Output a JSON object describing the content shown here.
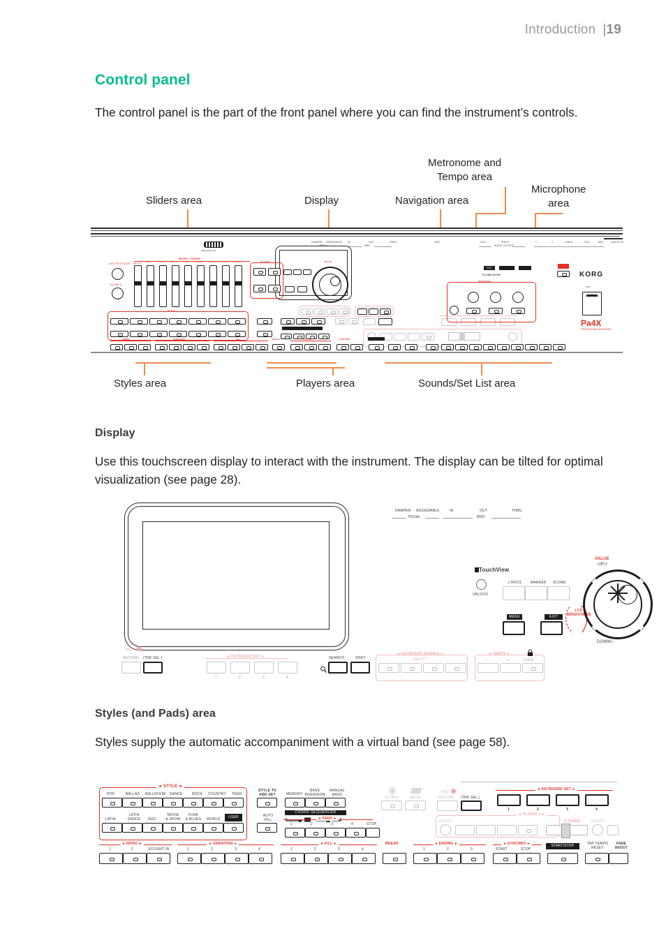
{
  "header": {
    "running_head": "Introduction",
    "page_number": "19",
    "folio_bar": "|"
  },
  "sections": [
    {
      "title": "Control panel",
      "body": "The control panel is the part of the front panel where you can find the instrument’s controls."
    },
    {
      "title": "Display",
      "body": "Use this touchscreen display to interact with the instrument. The display can be tilted for optimal visualization (see page 28)."
    },
    {
      "title": "Styles (and Pads) area",
      "body": "Styles supply the automatic accompaniment with a virtual band (see page 58)."
    }
  ],
  "figure_control_panel": {
    "callouts_top": [
      {
        "label": "Sliders area"
      },
      {
        "label": "Display"
      },
      {
        "label": "Navigation area"
      },
      {
        "label": "Metronome and\nTempo area",
        "line1": "Metronome and",
        "line2": "Tempo area"
      },
      {
        "label": "Microphone\narea",
        "line1": "Microphone",
        "line2": "area"
      }
    ],
    "callouts_bottom": [
      {
        "label": "Styles area"
      },
      {
        "label": "Players area"
      },
      {
        "label": "Sounds/Set List area"
      }
    ],
    "panel_text": {
      "brand": "KORG",
      "model": "Pa4X",
      "model_sub": "PROFESSIONAL ARRANGER",
      "speaker_label": "SPEAKER ON",
      "master_volume": "MASTER VOLUME",
      "balance": "BALANCE",
      "mixer_header": "MIXER / TUNING",
      "slider_labels": [
        "KBD VOL.",
        "PAD 1\nBASS",
        "PAD 2\nPERC.",
        "PAD 3\nGUITAR",
        "PAD 4\nACC 1",
        "LOWER\nACC 2",
        "UPPER 3\nACC 3",
        "UPPER 2\nACC 4",
        "UPPER 1\nDRUM"
      ],
      "player_header": "PLAYER",
      "player_buttons": [
        "SONG PLAY",
        "SONG PLAY",
        "SEQUENCER",
        "SOUND"
      ],
      "style_header": "STYLE",
      "style_row1": [
        "POP",
        "BALLAD",
        "BALLROOM",
        "DANCE",
        "ROCK",
        "COUNTRY",
        "TRAD."
      ],
      "style_row2": [
        "LATIN",
        "LATIN DANCE",
        "JAZZ",
        "MOVIE & SHOW",
        "FUNK & BLUES",
        "WORLD",
        "USER"
      ],
      "style_to_kbd_set": "STYLE TO\nKBD SET",
      "auto_fill": "AUTO\nFILL",
      "memory": "MEMORY",
      "bass_inversion": "BASS\nINVERSION",
      "manual_bass": "MANUAL\nBASS",
      "global": "GLOBAL",
      "media": "MEDIA",
      "intro": "INTRO",
      "variation": "VARIATION",
      "fill": "FILL",
      "break": "BREAK",
      "ending": "ENDING",
      "synchro": "SYNCHRO",
      "start_stop": "START/STOP",
      "tap_tempo_reset": "TAP TEMPO\nRESET",
      "fade_in_out": "FADE\nIN/OUT",
      "keyboard_set": "KEYBOARD SET",
      "x_fader": "X-FADER",
      "select": "SELECT",
      "record": "RECORD",
      "trk_sel": "TRK SEL.",
      "mp3": "mp3",
      "rear_labels": [
        "DAMPER",
        "ASSIGNABLE",
        "PEDAL",
        "IN",
        "OUT",
        "MIDI",
        "THRU",
        "USB",
        "LEFT",
        "RIGHT",
        "AUDIO OUTPUT",
        "1",
        "2",
        "VIDEO",
        "OUT",
        "MIC/",
        "AUDIO IN"
      ],
      "mic_header": "MIC/VOICE",
      "mic_knobs": [
        "MIC VOLUME",
        "HARMONY DOUBLE",
        "DELAY REVERB"
      ],
      "mic_buttons": [
        "MIC",
        "HARMONY",
        "DOUBLE"
      ],
      "tc_helicon": "TC·HELICON",
      "rx2": "RX2",
      "power": "POWER"
    }
  },
  "figure_display": {
    "panel_text": {
      "touchview": "TouchView",
      "unlock": "UNLOCK",
      "trk_sel": "TRK SEL.",
      "record": "RECORD",
      "mp3": "mp3",
      "keyboard_set": "KEYBOARD SET",
      "keyboard_set_numbers": [
        "1",
        "2",
        "3",
        "4"
      ],
      "search": "SEARCH",
      "shift": "SHIFT",
      "rear_labels": [
        "DAMPER",
        "ASSIGNABLE",
        "PEDAL",
        "IN",
        "OUT",
        "MIDI",
        "THRU"
      ],
      "lyrics": "LYRICS",
      "marker": "MARKER",
      "score": "SCORE",
      "lcd_brightness": "LCD\nBRIGHTNESS",
      "value": "VALUE",
      "up_plus": "UP/+",
      "down_minus": "DOWN/-",
      "keyboard_sounds": "KEYBOARD SOUNDS",
      "select": "SELECT",
      "tempo": "TEMPO",
      "tempo_minus": "−",
      "tempo_plus": "+",
      "lock": "LOCK",
      "menu": "MENU",
      "exit": "EXIT"
    }
  },
  "figure_styles": {
    "panel_text": {
      "style": "STYLE",
      "style_row1": [
        "POP",
        "BALLAD",
        "BALLROOM",
        "DANCE",
        "ROCK",
        "COUNTRY",
        "TRAD."
      ],
      "style_row2": [
        "LATIN",
        "LATIN\nDANCE",
        "JAZZ",
        "MOVIE\n& SHOW",
        "FUNK\n& BLUES",
        "WORLD",
        "USER"
      ],
      "style_to_kbd_set": "STYLE TO\nKBD SET",
      "auto_fill": "AUTO\nFILL",
      "memory": "MEMORY",
      "bass_inversion": "BASS\nINVERSION",
      "manual_bass": "MANUAL\nBASS",
      "global": "GLOBAL",
      "media": "MEDIA",
      "mp3": "mp3",
      "record": "RECORD",
      "trk_sel": "TRK SEL.",
      "chord_sequencer": "CHORD SEQUENCER",
      "pads": "PADS",
      "pad_numbers": [
        "1",
        "2",
        "3",
        "4"
      ],
      "stop": "STOP",
      "intro": "INTRO",
      "intro_numbers": [
        "1",
        "2",
        "3"
      ],
      "count_in": "COUNT IN",
      "variation": "VARIATION",
      "variation_numbers": [
        "1",
        "2",
        "3",
        "4"
      ],
      "fill": "FILL",
      "fill_numbers": [
        "1",
        "2",
        "3",
        "4"
      ],
      "break": "BREAK",
      "ending": "ENDING",
      "ending_numbers": [
        "1",
        "2",
        "3"
      ],
      "synchro": "SYNCHRO",
      "synchro_start": "START",
      "synchro_stop": "STOP",
      "start_stop": "START/STOP",
      "tap_tempo_reset": "TAP TEMPO\nRESET",
      "fade_in_out": "FADE\nIN/OUT",
      "keyboard_set": "KEYBOARD SET",
      "keyboard_set_numbers": [
        "1",
        "2",
        "3",
        "4"
      ],
      "player1": "PLAYER 1",
      "select": "SELECT",
      "x_fader": "X-FADER"
    }
  },
  "colors": {
    "heading": "#00bc8c",
    "leader": "#f08a4b",
    "silk_red": "#e03127",
    "text": "#231f20",
    "header_gray": "#9a9a9a"
  }
}
